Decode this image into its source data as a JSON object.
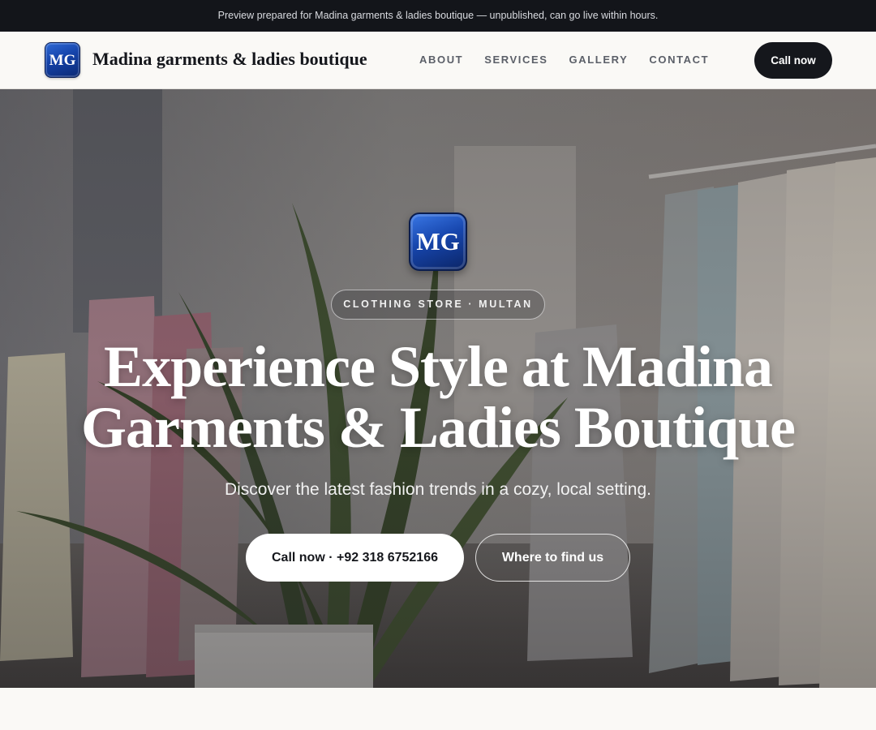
{
  "banner": {
    "text": "Preview prepared for Madina garments & ladies boutique — unpublished, can go live within hours."
  },
  "header": {
    "logo_initials": "MG",
    "brand_name": "Madina garments & ladies boutique",
    "nav": [
      "ABOUT",
      "SERVICES",
      "GALLERY",
      "CONTACT"
    ],
    "cta_label": "Call now"
  },
  "hero": {
    "logo_initials": "MG",
    "tag": "CLOTHING STORE · MULTAN",
    "title": "Experience Style at Madina Garments & Ladies Boutique",
    "subtitle": "Discover the latest fashion trends in a cozy, local setting.",
    "primary_button": "Call now · +92 318 6752166",
    "secondary_button": "Where to find us",
    "background_image": "boutique-interior-photo"
  },
  "colors": {
    "banner_bg": "#13151a",
    "header_bg": "#faf9f6",
    "ink": "#15171c",
    "nav_text": "#5b5f68",
    "logo_blue": "#1442a8",
    "hero_text": "#ffffff"
  }
}
